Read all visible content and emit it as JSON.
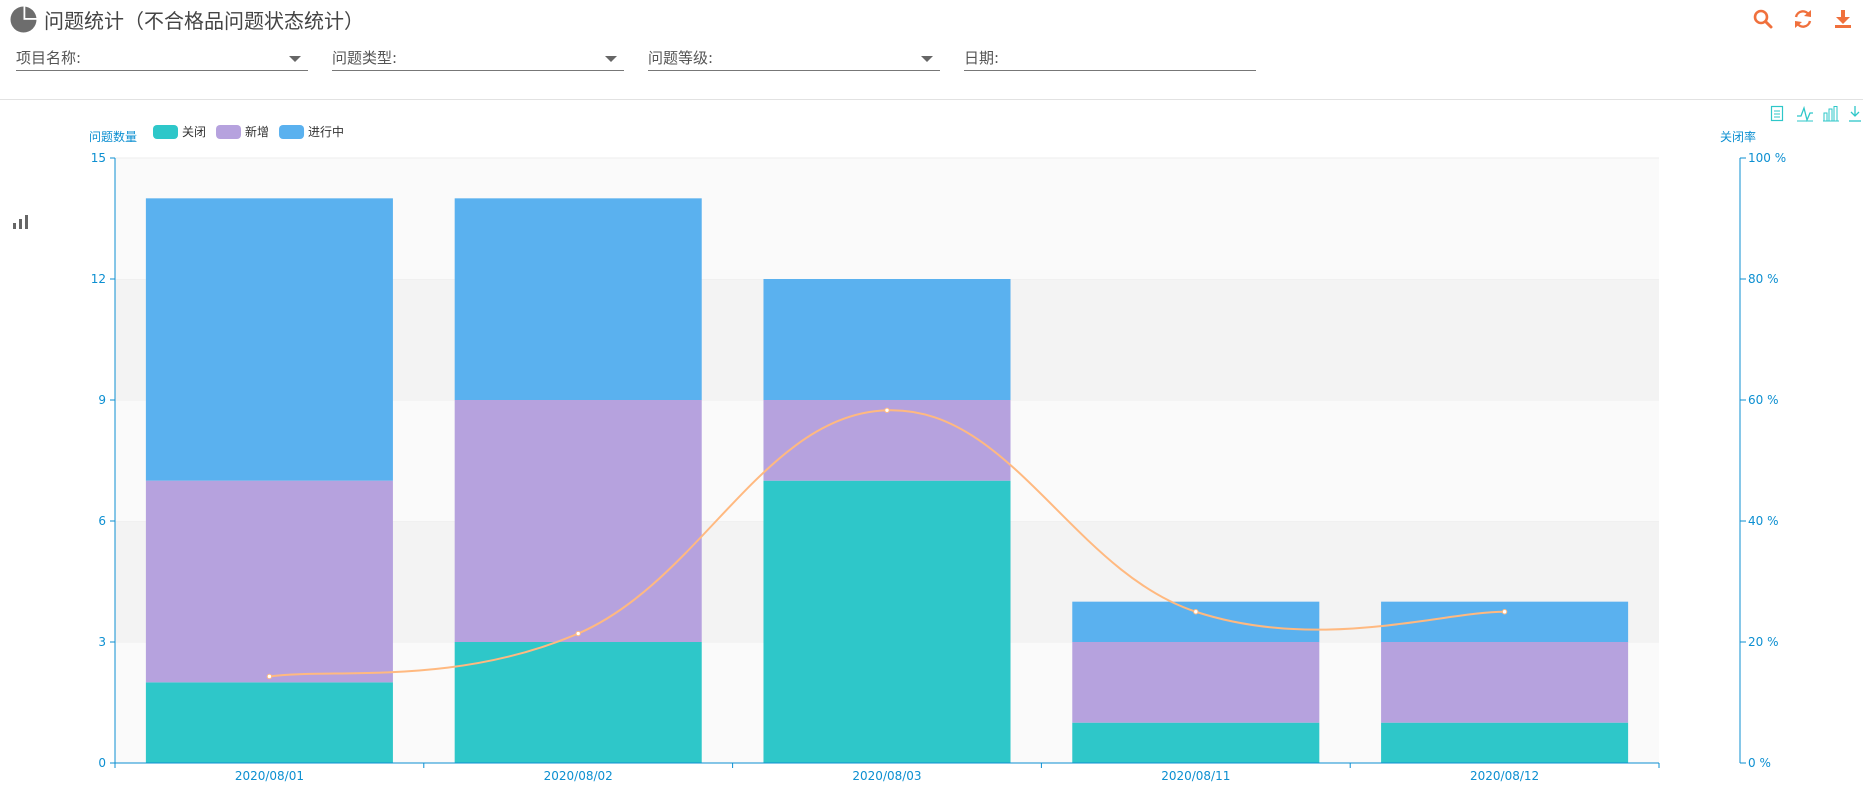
{
  "header": {
    "title": "问题统计（不合格品问题状态统计）",
    "icons": [
      "pie-chart-icon",
      "search-icon",
      "refresh-icon",
      "download-icon"
    ],
    "accent_color": "#f0703c"
  },
  "filters": [
    {
      "label": "项目名称:",
      "dropdown": true
    },
    {
      "label": "问题类型:",
      "dropdown": true
    },
    {
      "label": "问题等级:",
      "dropdown": true
    },
    {
      "label": "日期:",
      "dropdown": false
    }
  ],
  "chart_toolbar": [
    "data-view-icon",
    "line-chart-icon",
    "bar-chart-icon",
    "save-image-icon"
  ],
  "chart_data": {
    "type": "bar",
    "stacked": true,
    "categories": [
      "2020/08/01",
      "2020/08/02",
      "2020/08/03",
      "2020/08/11",
      "2020/08/12"
    ],
    "series": [
      {
        "name": "关闭",
        "type": "bar",
        "color": "#2ec7c9",
        "values": [
          2,
          3,
          7,
          1,
          1
        ]
      },
      {
        "name": "新增",
        "type": "bar",
        "color": "#b6a2de",
        "values": [
          5,
          6,
          2,
          2,
          2
        ]
      },
      {
        "name": "进行中",
        "type": "bar",
        "color": "#5ab1ef",
        "values": [
          7,
          5,
          3,
          1,
          1
        ]
      },
      {
        "type": "line",
        "axis": "right",
        "smooth": true,
        "color": "#ffb980",
        "values": [
          14.3,
          21.4,
          58.3,
          25.0,
          25.0
        ]
      }
    ],
    "ylabel": "问题数量",
    "ylim": [
      0,
      15
    ],
    "yticks": [
      0,
      3,
      6,
      9,
      12,
      15
    ],
    "y2label": "关闭率",
    "y2lim": [
      0,
      100
    ],
    "y2ticks": [
      "0 %",
      "20 %",
      "40 %",
      "60 %",
      "80 %",
      "100 %"
    ],
    "legend": "top-left",
    "grid": "alternating-bands",
    "axis_color": "#0c8fd1"
  }
}
